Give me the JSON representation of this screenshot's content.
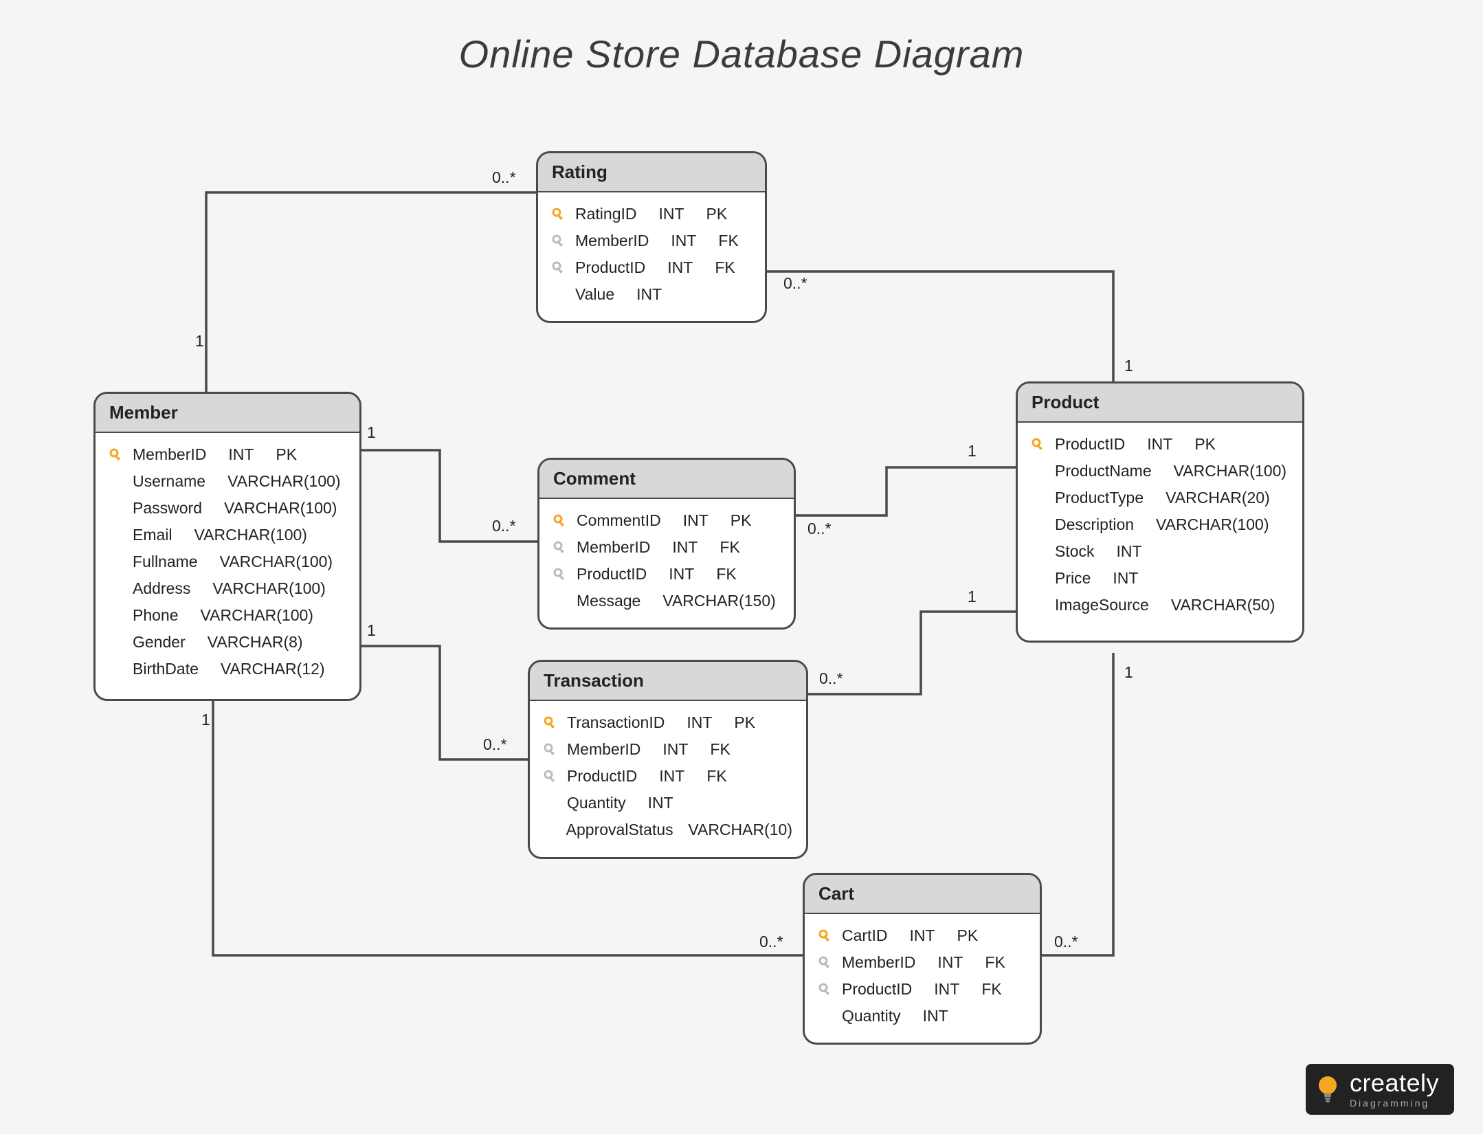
{
  "title": "Online Store Database Diagram",
  "entities": {
    "member": {
      "name": "Member",
      "fields": [
        {
          "icon": "pk",
          "name": "MemberID",
          "type": "INT",
          "key": "PK"
        },
        {
          "icon": "",
          "name": "Username",
          "type": "VARCHAR(100)",
          "key": ""
        },
        {
          "icon": "",
          "name": "Password",
          "type": "VARCHAR(100)",
          "key": ""
        },
        {
          "icon": "",
          "name": "Email",
          "type": "VARCHAR(100)",
          "key": ""
        },
        {
          "icon": "",
          "name": "Fullname",
          "type": "VARCHAR(100)",
          "key": ""
        },
        {
          "icon": "",
          "name": "Address",
          "type": "VARCHAR(100)",
          "key": ""
        },
        {
          "icon": "",
          "name": "Phone",
          "type": "VARCHAR(100)",
          "key": ""
        },
        {
          "icon": "",
          "name": "Gender",
          "type": "VARCHAR(8)",
          "key": ""
        },
        {
          "icon": "",
          "name": "BirthDate",
          "type": "VARCHAR(12)",
          "key": ""
        }
      ]
    },
    "rating": {
      "name": "Rating",
      "fields": [
        {
          "icon": "pk",
          "name": "RatingID",
          "type": "INT",
          "key": "PK"
        },
        {
          "icon": "fk",
          "name": "MemberID",
          "type": "INT",
          "key": "FK"
        },
        {
          "icon": "fk",
          "name": "ProductID",
          "type": "INT",
          "key": "FK"
        },
        {
          "icon": "",
          "name": "Value",
          "type": "INT",
          "key": ""
        }
      ]
    },
    "comment": {
      "name": "Comment",
      "fields": [
        {
          "icon": "pk",
          "name": "CommentID",
          "type": "INT",
          "key": "PK"
        },
        {
          "icon": "fk",
          "name": "MemberID",
          "type": "INT",
          "key": "FK"
        },
        {
          "icon": "fk",
          "name": "ProductID",
          "type": "INT",
          "key": "FK"
        },
        {
          "icon": "",
          "name": "Message",
          "type": "VARCHAR(150)",
          "key": ""
        }
      ]
    },
    "transaction": {
      "name": "Transaction",
      "fields": [
        {
          "icon": "pk",
          "name": "TransactionID",
          "type": "INT",
          "key": "PK"
        },
        {
          "icon": "fk",
          "name": "MemberID",
          "type": "INT",
          "key": "FK"
        },
        {
          "icon": "fk",
          "name": "ProductID",
          "type": "INT",
          "key": "FK"
        },
        {
          "icon": "",
          "name": "Quantity",
          "type": "INT",
          "key": ""
        },
        {
          "icon": "",
          "name": "ApprovalStatus",
          "type": "VARCHAR(10)",
          "key": ""
        }
      ]
    },
    "cart": {
      "name": "Cart",
      "fields": [
        {
          "icon": "pk",
          "name": "CartID",
          "type": "INT",
          "key": "PK"
        },
        {
          "icon": "fk",
          "name": "MemberID",
          "type": "INT",
          "key": "FK"
        },
        {
          "icon": "fk",
          "name": "ProductID",
          "type": "INT",
          "key": "FK"
        },
        {
          "icon": "",
          "name": "Quantity",
          "type": "INT",
          "key": ""
        }
      ]
    },
    "product": {
      "name": "Product",
      "fields": [
        {
          "icon": "pk",
          "name": "ProductID",
          "type": "INT",
          "key": "PK"
        },
        {
          "icon": "",
          "name": "ProductName",
          "type": "VARCHAR(100)",
          "key": ""
        },
        {
          "icon": "",
          "name": "ProductType",
          "type": "VARCHAR(20)",
          "key": ""
        },
        {
          "icon": "",
          "name": "Description",
          "type": "VARCHAR(100)",
          "key": ""
        },
        {
          "icon": "",
          "name": "Stock",
          "type": "INT",
          "key": ""
        },
        {
          "icon": "",
          "name": "Price",
          "type": "INT",
          "key": ""
        },
        {
          "icon": "",
          "name": "ImageSource",
          "type": "VARCHAR(50)",
          "key": ""
        }
      ]
    }
  },
  "relationships": [
    {
      "from": "Member",
      "to": "Rating",
      "from_mult": "1",
      "to_mult": "0..*"
    },
    {
      "from": "Product",
      "to": "Rating",
      "from_mult": "1",
      "to_mult": "0..*"
    },
    {
      "from": "Member",
      "to": "Comment",
      "from_mult": "1",
      "to_mult": "0..*"
    },
    {
      "from": "Product",
      "to": "Comment",
      "from_mult": "1",
      "to_mult": "0..*"
    },
    {
      "from": "Member",
      "to": "Transaction",
      "from_mult": "1",
      "to_mult": "0..*"
    },
    {
      "from": "Product",
      "to": "Transaction",
      "from_mult": "1",
      "to_mult": "0..*"
    },
    {
      "from": "Member",
      "to": "Cart",
      "from_mult": "1",
      "to_mult": "0..*"
    },
    {
      "from": "Product",
      "to": "Cart",
      "from_mult": "1",
      "to_mult": "0..*"
    }
  ],
  "multiplicity_labels": {
    "one": "1",
    "zero_many": "0..*"
  },
  "logo": {
    "brand": "creately",
    "tagline": "Diagramming"
  }
}
